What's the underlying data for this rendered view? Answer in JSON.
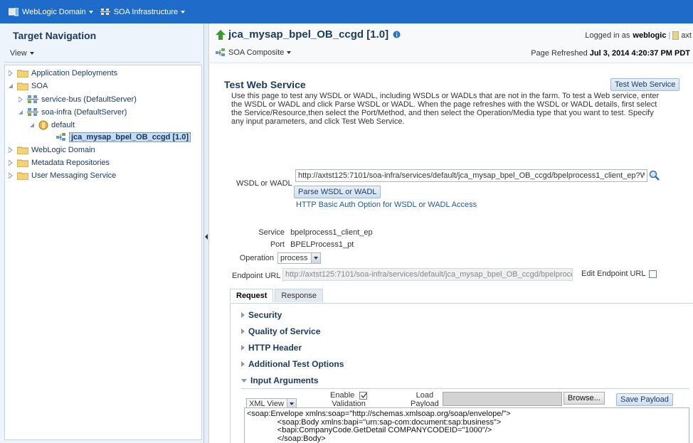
{
  "topbar": {
    "menu1": "WebLogic Domain",
    "menu2": "SOA Infrastructure"
  },
  "left": {
    "title": "Target Navigation",
    "view_menu": "View",
    "tree": [
      {
        "label": "Application Deployments"
      },
      {
        "label": "SOA"
      },
      {
        "label": "service-bus (DefaultServer)"
      },
      {
        "label": "soa-infra (DefaultServer)"
      },
      {
        "label": "default"
      },
      {
        "label": "jca_mysap_bpel_OB_ccgd [1.0]"
      },
      {
        "label": "WebLogic Domain"
      },
      {
        "label": "Metadata Repositories"
      },
      {
        "label": "User Messaging Service"
      }
    ]
  },
  "header": {
    "title": "jca_mysap_bpel_OB_ccgd [1.0]",
    "logged_in_prefix": "Logged in as",
    "user": "weblogic",
    "host_fragment": "axt",
    "composite_menu": "SOA Composite",
    "refreshed_prefix": "Page Refreshed",
    "refreshed_time": "Jul 3, 2014 4:20:37 PM PDT"
  },
  "test_ws": {
    "title": "Test Web Service",
    "button_label": "Test Web Service",
    "description": "Use this page to test any WSDL or WADL, including WSDLs or WADLs that are not in the farm. To test a Web service, enter the WSDL or WADL and click Parse WSDL or WADL. When the page refreshes with the WSDL or WADL details, first select the Service/Resource,then select the Port/Method, and then select the Operation/Media type that you want to test. Specify any input parameters, and click Test Web Service.",
    "wsdl_label": "WSDL or WADL",
    "wsdl_value": "http://axtst125:7101/soa-infra/services/default/jca_mysap_bpel_OB_ccgd/bpelprocess1_client_ep?WSDI",
    "parse_button": "Parse WSDL or WADL",
    "http_auth_link": "HTTP Basic Auth Option for WSDL or WADL Access",
    "service_label": "Service",
    "service_value": "bpelprocess1_client_ep",
    "port_label": "Port",
    "port_value": "BPELProcess1_pt",
    "operation_label": "Operation",
    "operation_value": "process",
    "endpoint_label": "Endpoint URL",
    "endpoint_value": "http://axtst125:7101/soa-infra/services/default/jca_mysap_bpel_OB_ccgd/bpelproce",
    "edit_endpoint_label": "Edit Endpoint URL"
  },
  "tabs": [
    {
      "label": "Request",
      "active": true
    },
    {
      "label": "Response",
      "active": false
    }
  ],
  "sections": {
    "security": "Security",
    "qos": "Quality of Service",
    "http_header": "HTTP Header",
    "additional": "Additional Test Options",
    "input_args": "Input Arguments"
  },
  "input_args": {
    "view_select": "XML View",
    "enable_label": "Enable",
    "validation_label": "Validation",
    "load_label": "Load",
    "payload_label": "Payload",
    "browse_button": "Browse...",
    "save_button": "Save Payload",
    "xml": "<soap:Envelope xmlns:soap=\"http://schemas.xmlsoap.org/soap/envelope/\">\n              <soap:Body xmlns:bapi=\"urn:sap-com:document:sap:business\">\n              <bapi:CompanyCode.GetDetail COMPANYCODEID=\"1000\"/>\n              </soap:Body>\n</soap:Envelope>"
  }
}
